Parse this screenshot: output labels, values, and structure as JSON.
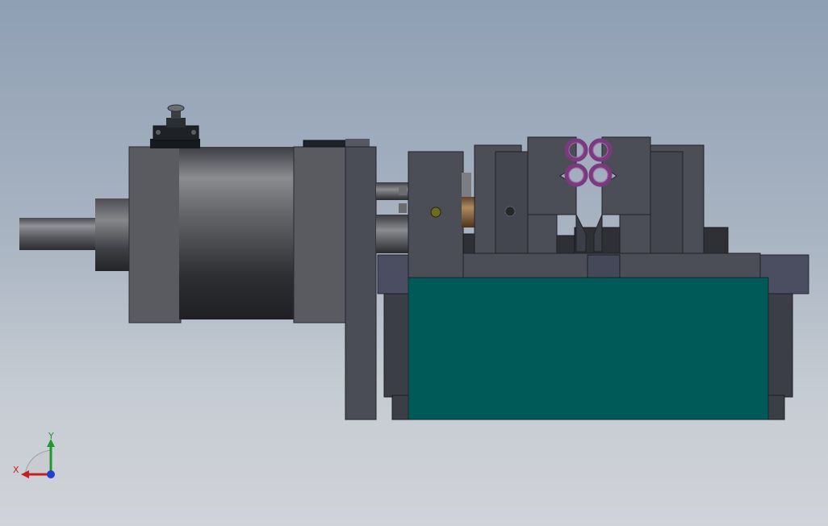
{
  "triad": {
    "x_label": "X",
    "y_label": "Y",
    "x_color": "#c8201e",
    "y_color": "#1e9a2a",
    "z_color": "#1e3fd0"
  },
  "colors": {
    "background_top": "#8f9fb4",
    "background_bottom": "#d0d3d8",
    "base_block": "#005a58",
    "frame": "#4a4d56",
    "plate": "#545763",
    "rollers": "#7a3b7e",
    "bronze_pin": "#8d6a45"
  }
}
